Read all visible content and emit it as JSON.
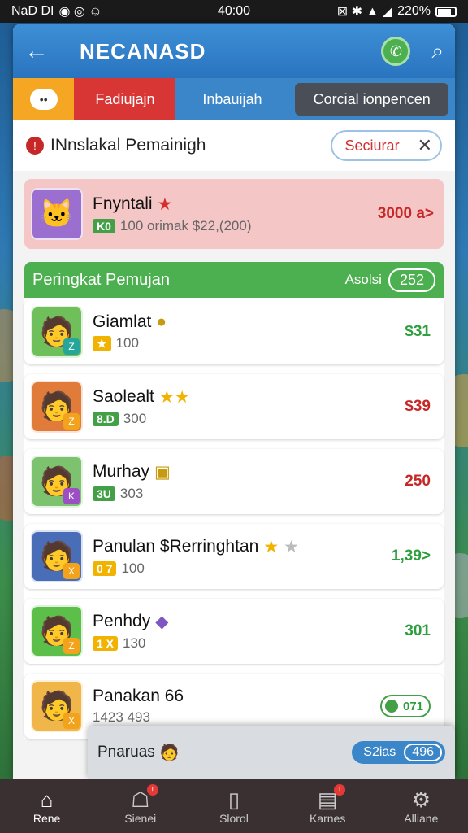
{
  "status_bar": {
    "left": "NaD DI",
    "time": "40:00",
    "battery": "220%"
  },
  "app_bar": {
    "title": "NECANASD"
  },
  "tabs": [
    {
      "label": "Fadiujajn"
    },
    {
      "label": "Inbauijah"
    },
    {
      "label": "Corcial ionpencen"
    }
  ],
  "filter": {
    "label": "INnslakal Pemainigh",
    "button_label": "Seciurar"
  },
  "featured": {
    "name": "Fnyntali",
    "tag": "K0",
    "sub": "100  orimak $22,(200)",
    "value": "3000 a>"
  },
  "ranking": {
    "title": "Peringkat Pemujan",
    "sub": "Asolsi",
    "count": "252"
  },
  "players": [
    {
      "name": "Giamlat",
      "tag": "★",
      "score": "100",
      "value": "$31",
      "value_color": "green",
      "avatar_bg": "#6fbf5a",
      "badge_bg": "#26a69a",
      "badge": "Z"
    },
    {
      "name": "Saolealt",
      "tag": "8.D",
      "score": "300",
      "value": "$39",
      "value_color": "red",
      "avatar_bg": "#e07b39",
      "badge_bg": "#f2a21b",
      "badge": "Z"
    },
    {
      "name": "Murhay",
      "tag": "3U",
      "score": "303",
      "value": "250",
      "value_color": "red",
      "avatar_bg": "#7cc26f",
      "badge_bg": "#9c4fc4",
      "badge": "K"
    },
    {
      "name": "Panulan $Rerringhtan",
      "tag": "0 7",
      "score": "100",
      "value": "1,39>",
      "value_color": "green",
      "avatar_bg": "#4a6db8",
      "badge_bg": "#f2a21b",
      "badge": "X"
    },
    {
      "name": "Penhdy",
      "tag": "1 X",
      "score": "130",
      "value": "301",
      "value_color": "green",
      "avatar_bg": "#5bbf4a",
      "badge_bg": "#f2a21b",
      "badge": "Z"
    },
    {
      "name": "Panakan 66",
      "tag": "",
      "score": "1423 493",
      "value": "071",
      "value_color": "green",
      "avatar_bg": "#f0b64a",
      "badge_bg": "#f2a21b",
      "badge": "X"
    }
  ],
  "overlay": {
    "name": "Pnaruas",
    "pill_label": "S2ias",
    "pill_count": "496"
  },
  "bottom_nav": [
    {
      "label": "Rene",
      "icon": "home-icon"
    },
    {
      "label": "Sienei",
      "icon": "chat-icon"
    },
    {
      "label": "Slorol",
      "icon": "bag-icon"
    },
    {
      "label": "Karnes",
      "icon": "cards-icon"
    },
    {
      "label": "Alliane",
      "icon": "settings-icon"
    }
  ]
}
